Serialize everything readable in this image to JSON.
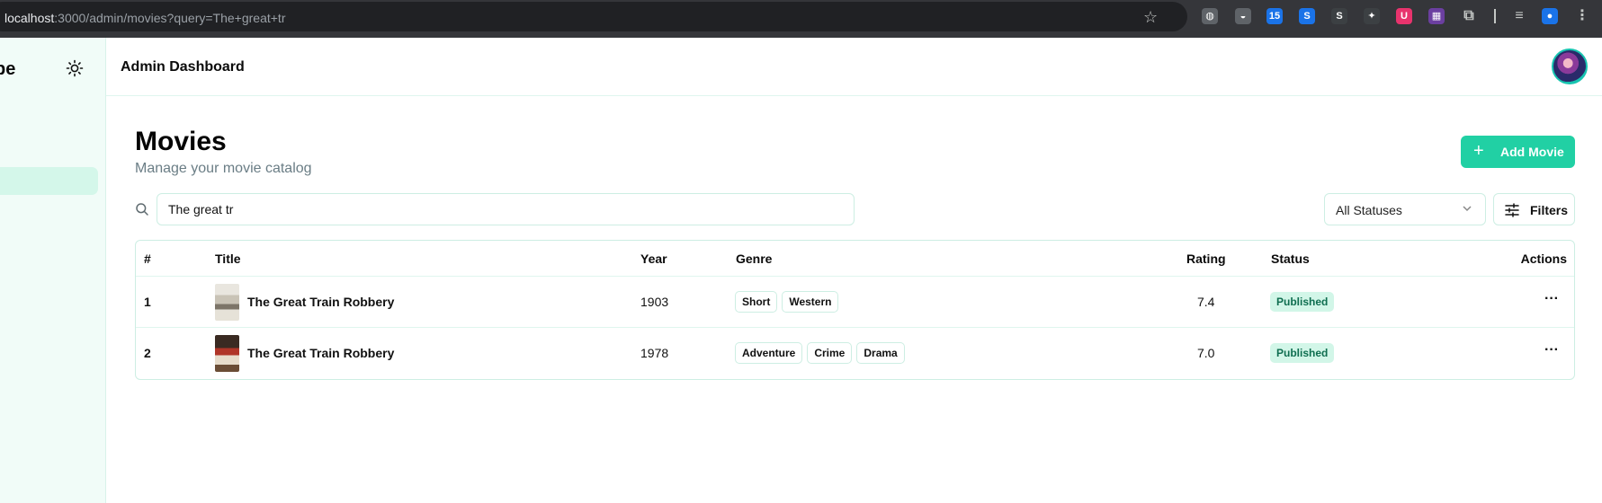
{
  "browser": {
    "url_host": "localhost",
    "url_rest": ":3000/admin/movies?query=The+great+tr",
    "star_icon": "star-icon",
    "extensions": [
      {
        "name": "extension-icon-1",
        "color": "#5f6368",
        "glyph": "◍"
      },
      {
        "name": "extension-icon-2",
        "color": "#5f6368",
        "glyph": "◒"
      },
      {
        "name": "extension-icon-3",
        "color": "#1a73e8",
        "glyph": "15"
      },
      {
        "name": "extension-icon-4",
        "color": "#1a73e8",
        "glyph": "S"
      },
      {
        "name": "extension-icon-5",
        "color": "#3c4043",
        "glyph": "S"
      },
      {
        "name": "extension-icon-6",
        "color": "#3c4043",
        "glyph": "✦"
      },
      {
        "name": "extension-icon-7",
        "color": "#e8336d",
        "glyph": "U"
      },
      {
        "name": "extension-icon-8",
        "color": "#6b3fa0",
        "glyph": "▦"
      },
      {
        "name": "extensions-puzzle-icon",
        "color": "transparent",
        "glyph": "⧉"
      },
      {
        "name": "media-control-icon",
        "color": "transparent",
        "glyph": "≡"
      },
      {
        "name": "profile-icon",
        "color": "#1a73e8",
        "glyph": "●"
      },
      {
        "name": "browser-menu-icon",
        "color": "transparent",
        "glyph": "⋮"
      }
    ]
  },
  "sidebar": {
    "brand_fragment": "pe",
    "theme_toggle_icon": "sun-icon"
  },
  "header": {
    "title": "Admin Dashboard",
    "avatar": "user-avatar"
  },
  "page": {
    "title": "Movies",
    "subtitle": "Manage your movie catalog",
    "add_button": "Add Movie"
  },
  "search": {
    "value": "The great tr",
    "placeholder": ""
  },
  "status_filter": {
    "selected": "All Statuses"
  },
  "filters_button": "Filters",
  "table": {
    "headers": {
      "num": "#",
      "title": "Title",
      "year": "Year",
      "genre": "Genre",
      "rating": "Rating",
      "status": "Status",
      "actions": "Actions"
    },
    "rows": [
      {
        "num": "1",
        "title": "The Great Train Robbery",
        "year": "1903",
        "genres": [
          "Short",
          "Western"
        ],
        "rating": "7.4",
        "status": "Published"
      },
      {
        "num": "2",
        "title": "The Great Train Robbery",
        "year": "1978",
        "genres": [
          "Adventure",
          "Crime",
          "Drama"
        ],
        "rating": "7.0",
        "status": "Published"
      }
    ]
  },
  "colors": {
    "accent": "#21d0a4",
    "sidebar_bg": "#f1fcf8",
    "badge_bg": "#d2f6e8",
    "badge_text": "#0f6e50"
  }
}
